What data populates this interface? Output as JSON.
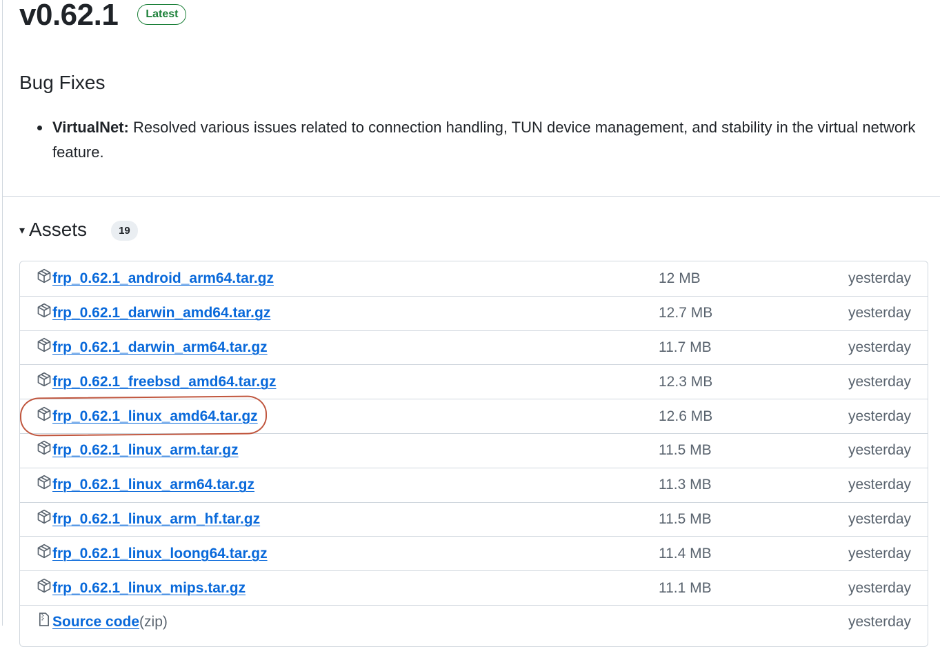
{
  "release": {
    "version": "v0.62.1",
    "badge": "Latest",
    "badge_color": "#1a7f37"
  },
  "notes": {
    "section_title": "Bug Fixes",
    "bullets": [
      {
        "bold": "VirtualNet:",
        "text": " Resolved various issues related to connection handling, TUN device management, and stability in the virtual network feature."
      }
    ]
  },
  "assets": {
    "title": "Assets",
    "caret": "▾",
    "count": "19",
    "link_color": "#0969da",
    "highlight_color": "#c0563e",
    "items": [
      {
        "name": "frp_0.62.1_android_arm64.tar.gz",
        "size": "12 MB",
        "date": "yesterday"
      },
      {
        "name": "frp_0.62.1_darwin_amd64.tar.gz",
        "size": "12.7 MB",
        "date": "yesterday"
      },
      {
        "name": "frp_0.62.1_darwin_arm64.tar.gz",
        "size": "11.7 MB",
        "date": "yesterday"
      },
      {
        "name": "frp_0.62.1_freebsd_amd64.tar.gz",
        "size": "12.3 MB",
        "date": "yesterday"
      },
      {
        "name": "frp_0.62.1_linux_amd64.tar.gz",
        "size": "12.6 MB",
        "date": "yesterday",
        "highlighted": true
      },
      {
        "name": "frp_0.62.1_linux_arm.tar.gz",
        "size": "11.5 MB",
        "date": "yesterday"
      },
      {
        "name": "frp_0.62.1_linux_arm64.tar.gz",
        "size": "11.3 MB",
        "date": "yesterday"
      },
      {
        "name": "frp_0.62.1_linux_arm_hf.tar.gz",
        "size": "11.5 MB",
        "date": "yesterday"
      },
      {
        "name": "frp_0.62.1_linux_loong64.tar.gz",
        "size": "11.4 MB",
        "date": "yesterday"
      },
      {
        "name": "frp_0.62.1_linux_mips.tar.gz",
        "size": "11.1 MB",
        "date": "yesterday"
      }
    ],
    "source": {
      "name": "Source code",
      "suffix": " (zip)",
      "date": "yesterday",
      "icon": "file-zip-icon"
    },
    "item_icon": "package-icon"
  }
}
